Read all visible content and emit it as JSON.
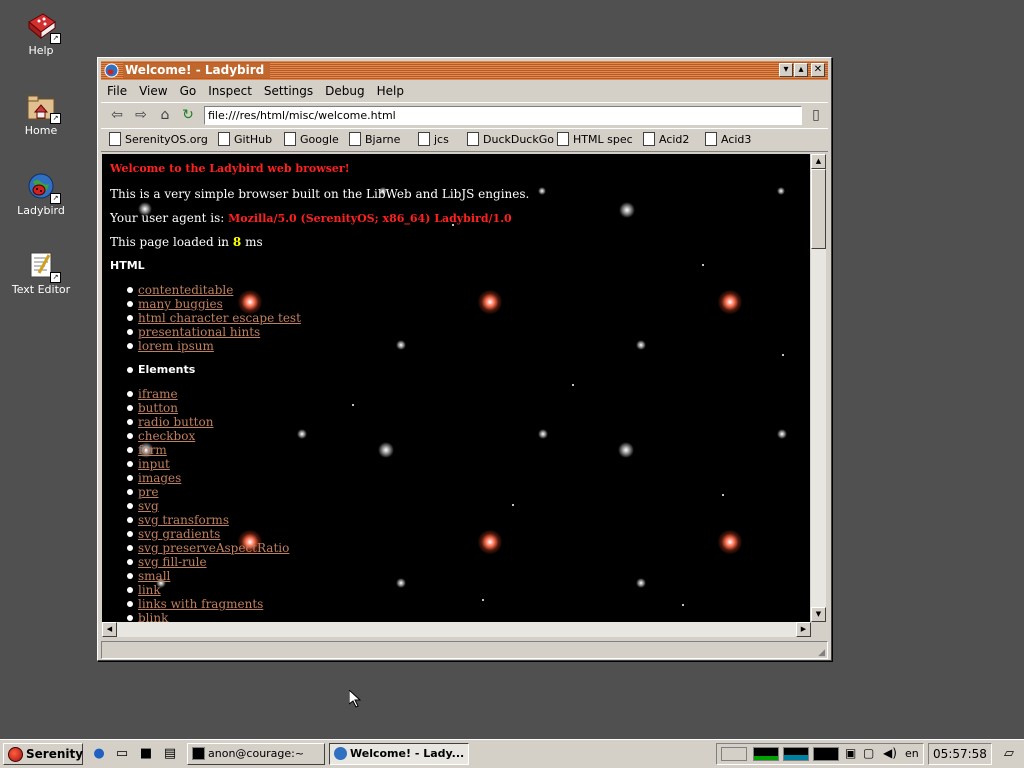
{
  "desktop": {
    "icons": [
      {
        "label": "Help"
      },
      {
        "label": "Home"
      },
      {
        "label": "Ladybird"
      },
      {
        "label": "Text Editor"
      }
    ]
  },
  "window": {
    "title": "Welcome! - Ladybird",
    "menu": [
      "File",
      "View",
      "Go",
      "Inspect",
      "Settings",
      "Debug",
      "Help"
    ],
    "url": "file:///res/html/misc/welcome.html",
    "bookmarks": [
      "SerenityOS.org",
      "GitHub",
      "Google",
      "Bjarne",
      "jcs",
      "DuckDuckGo",
      "HTML spec",
      "Acid2",
      "Acid3"
    ]
  },
  "page": {
    "heading": "Welcome to the Ladybird web browser!",
    "intro": "This is a very simple browser built on the LibWeb and LibJS engines.",
    "ua_label": "Your user agent is:",
    "ua_value": "Mozilla/5.0 (SerenityOS; x86_64) Ladybird/1.0",
    "loaded_prefix": "This page loaded in",
    "loaded_ms": "8",
    "loaded_suffix": "ms",
    "section_html": "HTML",
    "html_links": [
      "contenteditable",
      "many buggies",
      "html character escape test",
      "presentational hints",
      "lorem ipsum"
    ],
    "section_elements": "Elements",
    "element_links": [
      "iframe",
      "button",
      "radio button",
      "checkbox",
      "form",
      "input",
      "images",
      "pre",
      "svg",
      "svg transforms",
      "svg gradients",
      "svg preserveAspectRatio",
      "svg fill-rule",
      "small",
      "link",
      "links with fragments",
      "blink"
    ]
  },
  "taskbar": {
    "start_label": "Serenity",
    "tasks": [
      {
        "label": "anon@courage:~",
        "active": false
      },
      {
        "label": "Welcome! - Lady...",
        "active": true
      }
    ],
    "language": "en",
    "clock": "05:57:58"
  },
  "colors": {
    "desktop": "#505050",
    "titlebar": "#c0672e",
    "heading_red": "#ff2020",
    "link": "#c08060",
    "highlight_yellow": "#ffff00"
  }
}
